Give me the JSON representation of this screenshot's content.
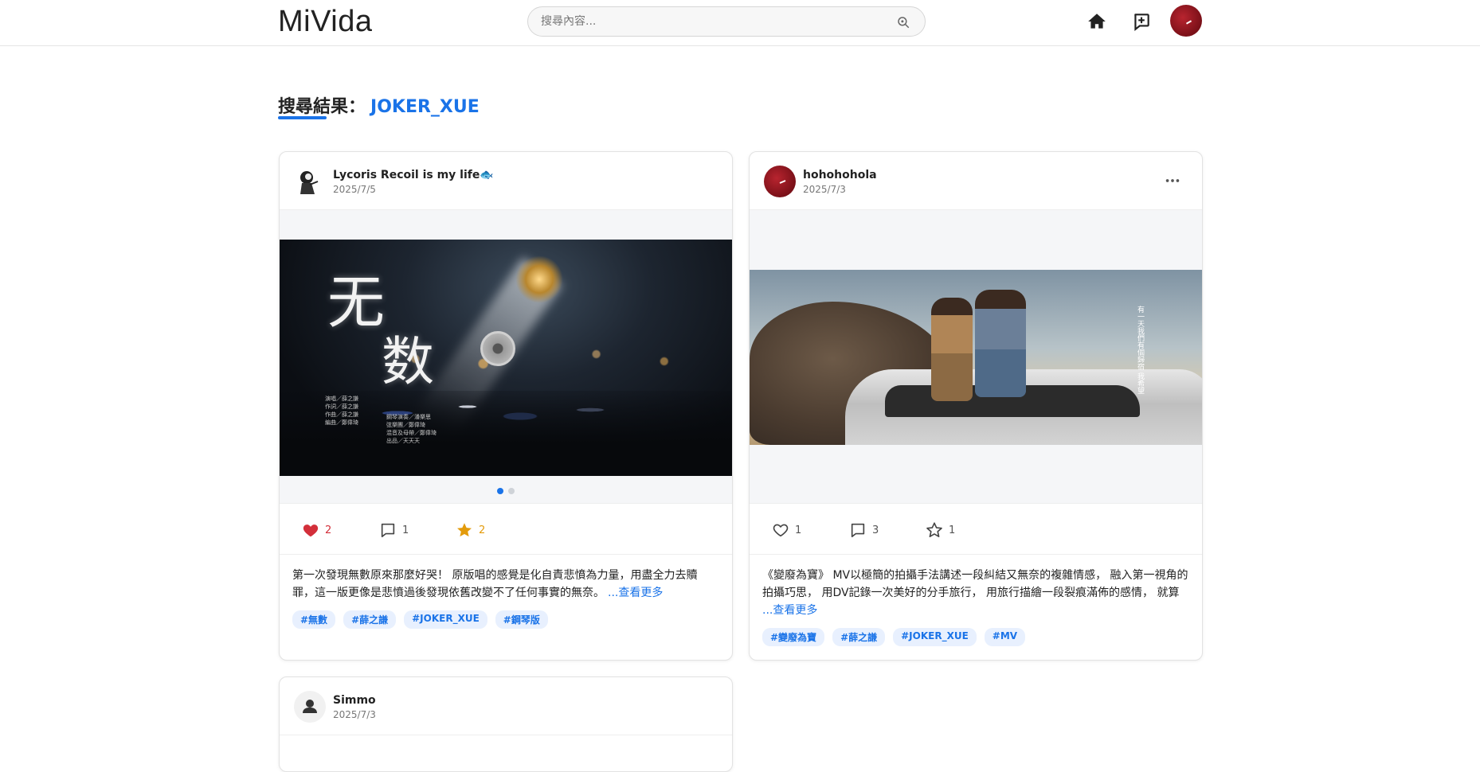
{
  "app": {
    "logo": "MiVida",
    "search_placeholder": "搜尋內容...",
    "search_icon": "search-icon",
    "nav": {
      "home_icon": "home-icon",
      "create_icon": "add-post-icon",
      "profile_icon": "avatar"
    }
  },
  "search": {
    "heading": "搜尋結果：",
    "keyword": "JOKER_XUE"
  },
  "posts": [
    {
      "user": "Lycoris Recoil is my life🐟",
      "date": "2025/7/5",
      "image_text": {
        "big1": "无",
        "big2": "数",
        "credits": "演唱／薛之謙\n作詞／薛之謙\n作曲／薛之謙\n編曲／鄭偉琦",
        "credits2": "鋼琴演奏／潘樂思\n弦樂團／鄭偉琦\n混音及母帶／鄭偉琦\n出品／天天天"
      },
      "carousel": {
        "count": 2,
        "active": 0
      },
      "likes": "2",
      "comments": "1",
      "stars": "2",
      "liked": true,
      "starred": true,
      "text": "第一次發現無數原來那麼好哭！ 原版唱的感覺是化自責悲憤為力量，用盡全力去贖罪，這一版更像是悲憤過後發現依舊改變不了任何事實的無奈。",
      "more": "...查看更多",
      "tags": [
        "#無數",
        "#薛之謙",
        "#JOKER_XUE",
        "#鋼琴版"
      ]
    },
    {
      "user": "hohohohola",
      "date": "2025/7/3",
      "image_text": {
        "vertical": "有一天我們有個歸宿 我希望"
      },
      "likes": "1",
      "comments": "3",
      "stars": "1",
      "liked": false,
      "starred": false,
      "text": "《變廢為寶》 MV以極簡的拍攝手法講述一段糾結又無奈的複雜情感， 融入第一視角的拍攝巧思， 用DV記錄一次美好的分手旅行， 用旅行描繪一段裂痕滿佈的感情， 就算",
      "more": "...查看更多",
      "tags": [
        "#變廢為寶",
        "#薛之謙",
        "#JOKER_XUE",
        "#MV"
      ]
    },
    {
      "user": "Simmo",
      "date": "2025/7/3"
    }
  ],
  "colors": {
    "accent": "#1a73e8",
    "like": "#d32f3a",
    "star": "#e39b0b"
  }
}
